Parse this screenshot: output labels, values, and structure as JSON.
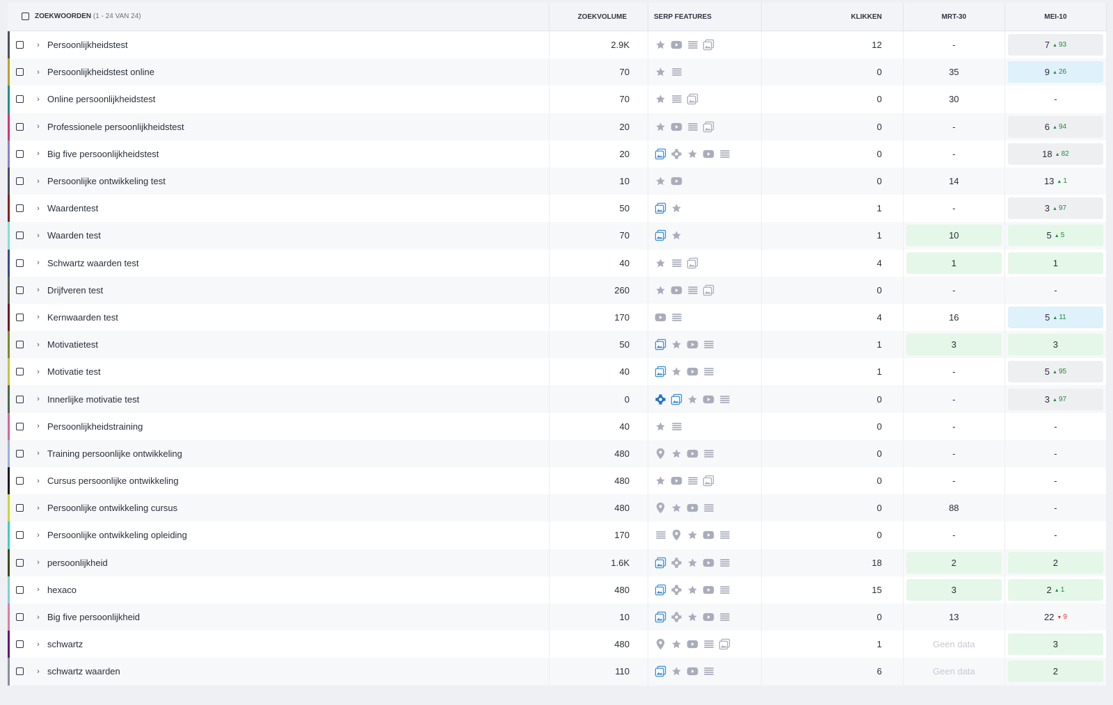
{
  "header": {
    "keywords_label": "ZOEKWOORDEN",
    "keywords_count": "(1 - 24 VAN 24)",
    "volume_label": "ZOEKVOLUME",
    "serp_label": "SERP FEATURES",
    "clicks_label": "KLIKKEN",
    "date1_label": "MRT-30",
    "date2_label": "MEI-10"
  },
  "rows": [
    {
      "keyword": "Persoonlijkheidstest",
      "color": "#4b4f5a",
      "volume": "2.9K",
      "icons": [
        "star",
        "video",
        "list",
        "image"
      ],
      "clicks": "12",
      "mrt": {
        "text": "-",
        "bg": ""
      },
      "mei": {
        "text": "7",
        "chg": "93",
        "dir": "up",
        "bg": "gray"
      }
    },
    {
      "keyword": "Persoonlijkheidstest online",
      "color": "#b9a42a",
      "volume": "70",
      "icons": [
        "star",
        "list"
      ],
      "clicks": "0",
      "mrt": {
        "text": "35",
        "bg": ""
      },
      "mei": {
        "text": "9",
        "chg": "26",
        "dir": "up",
        "bg": "blue"
      }
    },
    {
      "keyword": "Online persoonlijkheidstest",
      "color": "#1f8f8a",
      "volume": "70",
      "icons": [
        "star",
        "list",
        "image"
      ],
      "clicks": "0",
      "mrt": {
        "text": "30",
        "bg": ""
      },
      "mei": {
        "text": "-",
        "chg": "",
        "dir": "",
        "bg": ""
      }
    },
    {
      "keyword": "Professionele persoonlijkheidstest",
      "color": "#d6336c",
      "volume": "20",
      "icons": [
        "star",
        "video",
        "list",
        "image"
      ],
      "clicks": "0",
      "mrt": {
        "text": "-",
        "bg": ""
      },
      "mei": {
        "text": "6",
        "chg": "94",
        "dir": "up",
        "bg": "gray"
      }
    },
    {
      "keyword": "Big five persoonlijkheidstest",
      "color": "#8a7fd0",
      "volume": "20",
      "icons": [
        "image-blue",
        "puzzle",
        "star",
        "video",
        "list"
      ],
      "clicks": "0",
      "mrt": {
        "text": "-",
        "bg": ""
      },
      "mei": {
        "text": "18",
        "chg": "82",
        "dir": "up",
        "bg": "gray"
      }
    },
    {
      "keyword": "Persoonlijke ontwikkeling test",
      "color": "#4b4f5a",
      "volume": "10",
      "icons": [
        "star",
        "video"
      ],
      "clicks": "0",
      "mrt": {
        "text": "14",
        "bg": ""
      },
      "mei": {
        "text": "13",
        "chg": "1",
        "dir": "up",
        "bg": ""
      }
    },
    {
      "keyword": "Waardentest",
      "color": "#8b1e1e",
      "volume": "50",
      "icons": [
        "image-blue",
        "star"
      ],
      "clicks": "1",
      "mrt": {
        "text": "-",
        "bg": ""
      },
      "mei": {
        "text": "3",
        "chg": "97",
        "dir": "up",
        "bg": "gray"
      }
    },
    {
      "keyword": "Waarden test",
      "color": "#7fe0d6",
      "volume": "70",
      "icons": [
        "image-blue",
        "star"
      ],
      "clicks": "1",
      "mrt": {
        "text": "10",
        "bg": "green"
      },
      "mei": {
        "text": "5",
        "chg": "5",
        "dir": "up",
        "bg": "green"
      }
    },
    {
      "keyword": "Schwartz waarden test",
      "color": "#3b4a8a",
      "volume": "40",
      "icons": [
        "star",
        "list",
        "image"
      ],
      "clicks": "4",
      "mrt": {
        "text": "1",
        "bg": "green"
      },
      "mei": {
        "text": "1",
        "chg": "",
        "dir": "",
        "bg": "green"
      }
    },
    {
      "keyword": "Drijfveren test",
      "color": "#5a5f4a",
      "volume": "260",
      "icons": [
        "star",
        "video",
        "list",
        "image"
      ],
      "clicks": "0",
      "mrt": {
        "text": "-",
        "bg": ""
      },
      "mei": {
        "text": "-",
        "chg": "",
        "dir": "",
        "bg": ""
      }
    },
    {
      "keyword": "Kernwaarden test",
      "color": "#6b1a1a",
      "volume": "170",
      "icons": [
        "video",
        "list"
      ],
      "clicks": "4",
      "mrt": {
        "text": "16",
        "bg": ""
      },
      "mei": {
        "text": "5",
        "chg": "11",
        "dir": "up",
        "bg": "blue"
      }
    },
    {
      "keyword": "Motivatietest",
      "color": "#7a8a2a",
      "volume": "50",
      "icons": [
        "image-blue",
        "star",
        "video",
        "list"
      ],
      "clicks": "1",
      "mrt": {
        "text": "3",
        "bg": "green"
      },
      "mei": {
        "text": "3",
        "chg": "",
        "dir": "",
        "bg": "green"
      }
    },
    {
      "keyword": "Motivatie test",
      "color": "#c9c23a",
      "volume": "40",
      "icons": [
        "image-blue",
        "star",
        "video",
        "list"
      ],
      "clicks": "1",
      "mrt": {
        "text": "-",
        "bg": ""
      },
      "mei": {
        "text": "5",
        "chg": "95",
        "dir": "up",
        "bg": "gray"
      }
    },
    {
      "keyword": "Innerlijke motivatie test",
      "color": "#4a6a4a",
      "volume": "0",
      "icons": [
        "puzzle-blue",
        "image-blue",
        "star",
        "video",
        "list"
      ],
      "clicks": "0",
      "mrt": {
        "text": "-",
        "bg": ""
      },
      "mei": {
        "text": "3",
        "chg": "97",
        "dir": "up",
        "bg": "gray"
      }
    },
    {
      "keyword": "Persoonlijkheidstraining",
      "color": "#e0609a",
      "volume": "40",
      "icons": [
        "star",
        "list"
      ],
      "clicks": "0",
      "mrt": {
        "text": "-",
        "bg": ""
      },
      "mei": {
        "text": "-",
        "chg": "",
        "dir": "",
        "bg": ""
      }
    },
    {
      "keyword": "Training persoonlijke ontwikkeling",
      "color": "#9ab0e0",
      "volume": "480",
      "icons": [
        "pin",
        "star",
        "video",
        "list"
      ],
      "clicks": "0",
      "mrt": {
        "text": "-",
        "bg": ""
      },
      "mei": {
        "text": "-",
        "chg": "",
        "dir": "",
        "bg": ""
      }
    },
    {
      "keyword": "Cursus persoonlijke ontwikkeling",
      "color": "#1a1a1a",
      "volume": "480",
      "icons": [
        "star",
        "video",
        "list",
        "image"
      ],
      "clicks": "0",
      "mrt": {
        "text": "-",
        "bg": ""
      },
      "mei": {
        "text": "-",
        "chg": "",
        "dir": "",
        "bg": ""
      }
    },
    {
      "keyword": "Persoonlijke ontwikkeling cursus",
      "color": "#c8d82a",
      "volume": "480",
      "icons": [
        "pin",
        "star",
        "video",
        "list"
      ],
      "clicks": "0",
      "mrt": {
        "text": "88",
        "bg": ""
      },
      "mei": {
        "text": "-",
        "chg": "",
        "dir": "",
        "bg": ""
      }
    },
    {
      "keyword": "Persoonlijke ontwikkeling opleiding",
      "color": "#3ad0c0",
      "volume": "170",
      "icons": [
        "list",
        "pin",
        "star",
        "video",
        "list"
      ],
      "clicks": "0",
      "mrt": {
        "text": "-",
        "bg": ""
      },
      "mei": {
        "text": "-",
        "chg": "",
        "dir": "",
        "bg": ""
      }
    },
    {
      "keyword": "persoonlijkheid",
      "color": "#3a4a1a",
      "volume": "1.6K",
      "icons": [
        "image-blue",
        "puzzle",
        "star",
        "video",
        "list"
      ],
      "clicks": "18",
      "mrt": {
        "text": "2",
        "bg": "green"
      },
      "mei": {
        "text": "2",
        "chg": "",
        "dir": "",
        "bg": "green"
      }
    },
    {
      "keyword": "hexaco",
      "color": "#7ad0e0",
      "volume": "480",
      "icons": [
        "image-blue",
        "puzzle",
        "star",
        "video",
        "list"
      ],
      "clicks": "15",
      "mrt": {
        "text": "3",
        "bg": "green"
      },
      "mei": {
        "text": "2",
        "chg": "1",
        "dir": "up",
        "bg": "green"
      }
    },
    {
      "keyword": "Big five persoonlijkheid",
      "color": "#e07aa0",
      "volume": "10",
      "icons": [
        "image-blue",
        "puzzle",
        "star",
        "video",
        "list"
      ],
      "clicks": "0",
      "mrt": {
        "text": "13",
        "bg": ""
      },
      "mei": {
        "text": "22",
        "chg": "9",
        "dir": "down",
        "bg": ""
      }
    },
    {
      "keyword": "schwartz",
      "color": "#5a1a7a",
      "volume": "480",
      "icons": [
        "pin",
        "star",
        "video",
        "list",
        "image"
      ],
      "clicks": "1",
      "mrt": {
        "text": "Geen data",
        "bg": "nodata"
      },
      "mei": {
        "text": "3",
        "chg": "",
        "dir": "",
        "bg": "green"
      }
    },
    {
      "keyword": "schwartz waarden",
      "color": "#8a8f9a",
      "volume": "110",
      "icons": [
        "image-blue",
        "star",
        "video",
        "list"
      ],
      "clicks": "6",
      "mrt": {
        "text": "Geen data",
        "bg": "nodata"
      },
      "mei": {
        "text": "2",
        "chg": "",
        "dir": "",
        "bg": "green"
      }
    }
  ],
  "icon_names": {
    "star": "star-icon",
    "video": "video-icon",
    "list": "list-icon",
    "image": "image-icon",
    "image-blue": "image-pack-icon",
    "puzzle": "knowledge-panel-icon",
    "puzzle-blue": "knowledge-panel-icon",
    "pin": "local-pack-icon"
  },
  "arrows": {
    "up": "▲",
    "down": "▼"
  },
  "colors": {
    "icon_gray": "#a9adbb",
    "icon_blue": "#3a8fd6",
    "pill_green": "#e5f7e8",
    "pill_blue": "#dff1fb",
    "pill_gray": "#eeeff1"
  }
}
